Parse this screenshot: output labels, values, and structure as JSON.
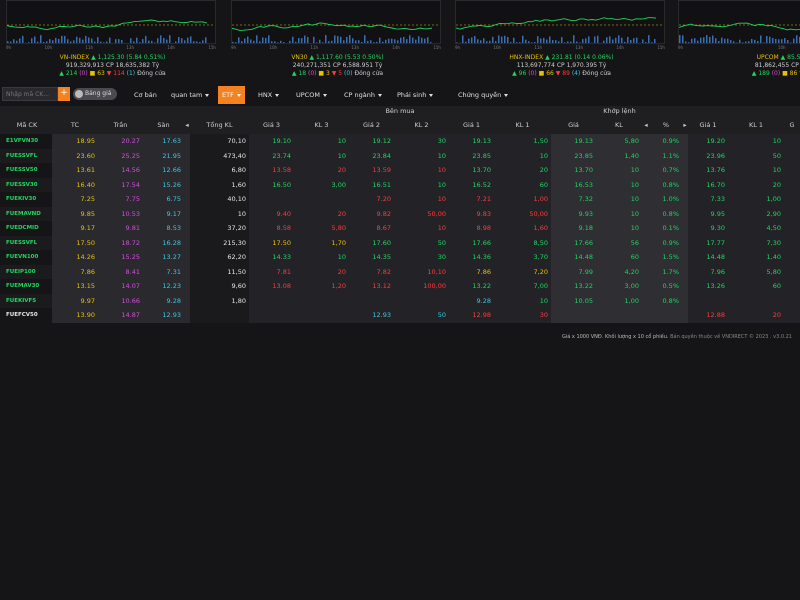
{
  "charts": [
    {
      "name": "VN-INDEX",
      "value": "1,125.30",
      "change": "(5.84 0.51%)",
      "direction": "up",
      "volume": "919,329,913",
      "value_label": "CP",
      "trade_value": "18,635,382",
      "unit": "Tỷ",
      "up_count": "214",
      "ref_count": "(0)",
      "mid_count": "63",
      "down_count": "114",
      "ceil_count": "(1)",
      "status": "Đóng cửa",
      "ticks": [
        "9h",
        "10h",
        "11h",
        "13h",
        "14h",
        "15h"
      ]
    },
    {
      "name": "VN30",
      "value": "1,117.60",
      "change": "(5.53 0.50%)",
      "direction": "up",
      "volume": "240,271,351",
      "value_label": "CP",
      "trade_value": "6,588.951",
      "unit": "Tỷ",
      "up_count": "18",
      "ref_count": "(0)",
      "mid_count": "3",
      "down_count": "5",
      "ceil_count": "(0)",
      "status": "Đóng cửa",
      "ticks": [
        "9h",
        "10h",
        "11h",
        "13h",
        "14h",
        "15h"
      ]
    },
    {
      "name": "HNX-INDEX",
      "value": "231.81",
      "change": "(0.14 0.06%)",
      "direction": "up",
      "volume": "113,697,774",
      "value_label": "CP",
      "trade_value": "1,970.395",
      "unit": "Tỷ",
      "up_count": "96",
      "ref_count": "(0)",
      "mid_count": "66",
      "down_count": "89",
      "ceil_count": "(4)",
      "status": "Đóng cửa",
      "ticks": [
        "9h",
        "10h",
        "11h",
        "13h",
        "14h",
        "15h"
      ]
    },
    {
      "name": "UPCOM",
      "value": "85.59",
      "change": "(0",
      "direction": "up",
      "volume": "81,862,455",
      "value_label": "CP",
      "trade_value": "1,07",
      "unit": "",
      "up_count": "189",
      "ref_count": "(0)",
      "mid_count": "86",
      "down_count": "107",
      "ceil_count": "",
      "status": "",
      "ticks": [
        "9h",
        "10h",
        "11h"
      ]
    }
  ],
  "toolbar": {
    "search_placeholder": "Nhập mã CK...",
    "add_label": "+",
    "toggle_label": "Bảng giá",
    "menu": [
      {
        "label": "Cơ bản",
        "caret": false,
        "active": false
      },
      {
        "label": "quan tam",
        "caret": true,
        "active": false
      },
      {
        "label": "ETF",
        "caret": true,
        "active": true
      },
      {
        "label": "HNX",
        "caret": true,
        "active": false
      },
      {
        "label": "UPCOM",
        "caret": true,
        "active": false
      },
      {
        "label": "CP ngành",
        "caret": true,
        "active": false
      },
      {
        "label": "Phái sinh",
        "caret": true,
        "active": false
      },
      {
        "label": "Chứng quyền",
        "caret": true,
        "active": false
      }
    ]
  },
  "table": {
    "group_headers": {
      "buy": "Bên mua",
      "match": "Khớp lệnh"
    },
    "columns": [
      "Mã CK",
      "TC",
      "Trần",
      "Sàn",
      "◂",
      "Tổng KL",
      "Giá 3",
      "KL 3",
      "Giá 2",
      "KL 2",
      "Giá 1",
      "KL 1",
      "Giá",
      "KL",
      "◂",
      "%",
      "▸",
      "Giá 1",
      "KL 1",
      "G"
    ],
    "rows": [
      {
        "sym": "E1VFVN30",
        "symc": "up",
        "tc": "18.95",
        "tran": "20.27",
        "san": "17.63",
        "total": "70,10",
        "b3": [
          "19.10",
          "up"
        ],
        "k3": [
          "10",
          "up"
        ],
        "b2": [
          "19.12",
          "up"
        ],
        "k2": [
          "30",
          "up"
        ],
        "b1": [
          "19.13",
          "up"
        ],
        "k1": [
          "1,50",
          "up"
        ],
        "mp": [
          "19.13",
          "up"
        ],
        "mk": [
          "5,80",
          "up"
        ],
        "pct": [
          "0.9%",
          "up"
        ],
        "s1": [
          "19.20",
          "up"
        ],
        "sk1": [
          "10",
          "up"
        ]
      },
      {
        "sym": "FUESSVFL",
        "symc": "up",
        "tc": "23.60",
        "tran": "25.25",
        "san": "21.95",
        "total": "473,40",
        "b3": [
          "23.74",
          "up"
        ],
        "k3": [
          "10",
          "up"
        ],
        "b2": [
          "23.84",
          "up"
        ],
        "k2": [
          "10",
          "up"
        ],
        "b1": [
          "23.85",
          "up"
        ],
        "k1": [
          "10",
          "up"
        ],
        "mp": [
          "23.85",
          "up"
        ],
        "mk": [
          "1,40",
          "up"
        ],
        "pct": [
          "1.1%",
          "up"
        ],
        "s1": [
          "23.96",
          "up"
        ],
        "sk1": [
          "50",
          "up"
        ]
      },
      {
        "sym": "FUESSV50",
        "symc": "up",
        "tc": "13.61",
        "tran": "14.56",
        "san": "12.66",
        "total": "6,80",
        "b3": [
          "13.58",
          "dn"
        ],
        "k3": [
          "20",
          "dn"
        ],
        "b2": [
          "13.59",
          "dn"
        ],
        "k2": [
          "10",
          "dn"
        ],
        "b1": [
          "13.70",
          "up"
        ],
        "k1": [
          "20",
          "up"
        ],
        "mp": [
          "13.70",
          "up"
        ],
        "mk": [
          "10",
          "up"
        ],
        "pct": [
          "0.7%",
          "up"
        ],
        "s1": [
          "13.76",
          "up"
        ],
        "sk1": [
          "10",
          "up"
        ]
      },
      {
        "sym": "FUESSV30",
        "symc": "up",
        "tc": "16.40",
        "tran": "17.54",
        "san": "15.26",
        "total": "1,60",
        "b3": [
          "16.50",
          "up"
        ],
        "k3": [
          "3,00",
          "up"
        ],
        "b2": [
          "16.51",
          "up"
        ],
        "k2": [
          "10",
          "up"
        ],
        "b1": [
          "16.52",
          "up"
        ],
        "k1": [
          "60",
          "up"
        ],
        "mp": [
          "16.53",
          "up"
        ],
        "mk": [
          "10",
          "up"
        ],
        "pct": [
          "0.8%",
          "up"
        ],
        "s1": [
          "16.70",
          "up"
        ],
        "sk1": [
          "20",
          "up"
        ]
      },
      {
        "sym": "FUEKIV30",
        "symc": "up",
        "tc": "7.25",
        "tran": "7.75",
        "san": "6.75",
        "total": "40,10",
        "b3": [
          "",
          "up"
        ],
        "k3": [
          "",
          "up"
        ],
        "b2": [
          "7.20",
          "dn"
        ],
        "k2": [
          "10",
          "dn"
        ],
        "b1": [
          "7.21",
          "dn"
        ],
        "k1": [
          "1,00",
          "dn"
        ],
        "mp": [
          "7.32",
          "up"
        ],
        "mk": [
          "10",
          "up"
        ],
        "pct": [
          "1.0%",
          "up"
        ],
        "s1": [
          "7.33",
          "up"
        ],
        "sk1": [
          "1,00",
          "up"
        ]
      },
      {
        "sym": "FUEMAVND",
        "symc": "up",
        "tc": "9.85",
        "tran": "10.53",
        "san": "9.17",
        "total": "10",
        "b3": [
          "9.40",
          "dn"
        ],
        "k3": [
          "20",
          "dn"
        ],
        "b2": [
          "9.82",
          "dn"
        ],
        "k2": [
          "50,00",
          "dn"
        ],
        "b1": [
          "9.83",
          "dn"
        ],
        "k1": [
          "50,00",
          "dn"
        ],
        "mp": [
          "9.93",
          "up"
        ],
        "mk": [
          "10",
          "up"
        ],
        "pct": [
          "0.8%",
          "up"
        ],
        "s1": [
          "9.95",
          "up"
        ],
        "sk1": [
          "2,90",
          "up"
        ]
      },
      {
        "sym": "FUEDCMID",
        "symc": "up",
        "tc": "9.17",
        "tran": "9.81",
        "san": "8.53",
        "total": "37,20",
        "b3": [
          "8.58",
          "dn"
        ],
        "k3": [
          "5,80",
          "dn"
        ],
        "b2": [
          "8.67",
          "dn"
        ],
        "k2": [
          "10",
          "dn"
        ],
        "b1": [
          "8.98",
          "dn"
        ],
        "k1": [
          "1,60",
          "dn"
        ],
        "mp": [
          "9.18",
          "up"
        ],
        "mk": [
          "10",
          "up"
        ],
        "pct": [
          "0.1%",
          "up"
        ],
        "s1": [
          "9.30",
          "up"
        ],
        "sk1": [
          "4,50",
          "up"
        ]
      },
      {
        "sym": "FUESSVFL",
        "symc": "up",
        "tc": "17.50",
        "tran": "18.72",
        "san": "16.28",
        "total": "215,30",
        "b3": [
          "17.50",
          "ref"
        ],
        "k3": [
          "1,70",
          "ref"
        ],
        "b2": [
          "17.60",
          "up"
        ],
        "k2": [
          "50",
          "up"
        ],
        "b1": [
          "17.66",
          "up"
        ],
        "k1": [
          "8,50",
          "up"
        ],
        "mp": [
          "17.66",
          "up"
        ],
        "mk": [
          "56",
          "up"
        ],
        "pct": [
          "0.9%",
          "up"
        ],
        "s1": [
          "17.77",
          "up"
        ],
        "sk1": [
          "7,30",
          "up"
        ]
      },
      {
        "sym": "FUEVN100",
        "symc": "up",
        "tc": "14.26",
        "tran": "15.25",
        "san": "13.27",
        "total": "62,20",
        "b3": [
          "14.33",
          "up"
        ],
        "k3": [
          "10",
          "up"
        ],
        "b2": [
          "14.35",
          "up"
        ],
        "k2": [
          "30",
          "up"
        ],
        "b1": [
          "14.36",
          "up"
        ],
        "k1": [
          "3,70",
          "up"
        ],
        "mp": [
          "14.48",
          "up"
        ],
        "mk": [
          "60",
          "up"
        ],
        "pct": [
          "1.5%",
          "up"
        ],
        "s1": [
          "14.48",
          "up"
        ],
        "sk1": [
          "1,40",
          "up"
        ]
      },
      {
        "sym": "FUEIP100",
        "symc": "up",
        "tc": "7.86",
        "tran": "8.41",
        "san": "7.31",
        "total": "11,50",
        "b3": [
          "7.81",
          "dn"
        ],
        "k3": [
          "20",
          "dn"
        ],
        "b2": [
          "7.82",
          "dn"
        ],
        "k2": [
          "10,10",
          "dn"
        ],
        "b1": [
          "7.86",
          "ref"
        ],
        "k1": [
          "7,20",
          "ref"
        ],
        "mp": [
          "7.99",
          "up"
        ],
        "mk": [
          "4,20",
          "up"
        ],
        "pct": [
          "1.7%",
          "up"
        ],
        "s1": [
          "7.96",
          "up"
        ],
        "sk1": [
          "5,80",
          "up"
        ]
      },
      {
        "sym": "FUEMAV30",
        "symc": "up",
        "tc": "13.15",
        "tran": "14.07",
        "san": "12.23",
        "total": "9,60",
        "b3": [
          "13.08",
          "dn"
        ],
        "k3": [
          "1,20",
          "dn"
        ],
        "b2": [
          "13.12",
          "dn"
        ],
        "k2": [
          "100,00",
          "dn"
        ],
        "b1": [
          "13.22",
          "up"
        ],
        "k1": [
          "7,00",
          "up"
        ],
        "mp": [
          "13.22",
          "up"
        ],
        "mk": [
          "3,00",
          "up"
        ],
        "pct": [
          "0.5%",
          "up"
        ],
        "s1": [
          "13.26",
          "up"
        ],
        "sk1": [
          "60",
          "up"
        ]
      },
      {
        "sym": "FUEKIVFS",
        "symc": "up",
        "tc": "9.97",
        "tran": "10.66",
        "san": "9.28",
        "total": "1,80",
        "b3": [
          "",
          "up"
        ],
        "k3": [
          "",
          "up"
        ],
        "b2": [
          "",
          "up"
        ],
        "k2": [
          "",
          "up"
        ],
        "b1": [
          "9.28",
          "floor"
        ],
        "k1": [
          "10",
          "up"
        ],
        "mp": [
          "10.05",
          "up"
        ],
        "mk": [
          "1,00",
          "up"
        ],
        "pct": [
          "0.8%",
          "up"
        ],
        "s1": [
          "",
          "up"
        ],
        "sk1": [
          "",
          "up"
        ]
      },
      {
        "sym": "FUEFCV50",
        "symc": "white",
        "tc": "13.90",
        "tran": "14.87",
        "san": "12.93",
        "total": "",
        "b3": [
          "",
          "up"
        ],
        "k3": [
          "",
          "up"
        ],
        "b2": [
          "12.93",
          "floor"
        ],
        "k2": [
          "50",
          "floor"
        ],
        "b1": [
          "12.98",
          "dn"
        ],
        "k1": [
          "30",
          "dn"
        ],
        "mp": [
          "",
          "up"
        ],
        "mk": [
          "",
          "up"
        ],
        "pct": [
          "",
          "up"
        ],
        "s1": [
          "12.88",
          "dn"
        ],
        "sk1": [
          "20",
          "dn"
        ]
      }
    ]
  },
  "footer": {
    "note": "Giá x 1000 VNĐ. Khối lượng x 10 cổ phiếu.",
    "copyright": "Bản quyền thuộc về VNDIRECT © 2023 . v3.0.21"
  },
  "colors": {
    "up": "#1ed760",
    "down": "#ff3b3b",
    "ref": "#e8c200",
    "ceil": "#d44ddb",
    "floor": "#38c8e6",
    "accent": "#f58220"
  }
}
